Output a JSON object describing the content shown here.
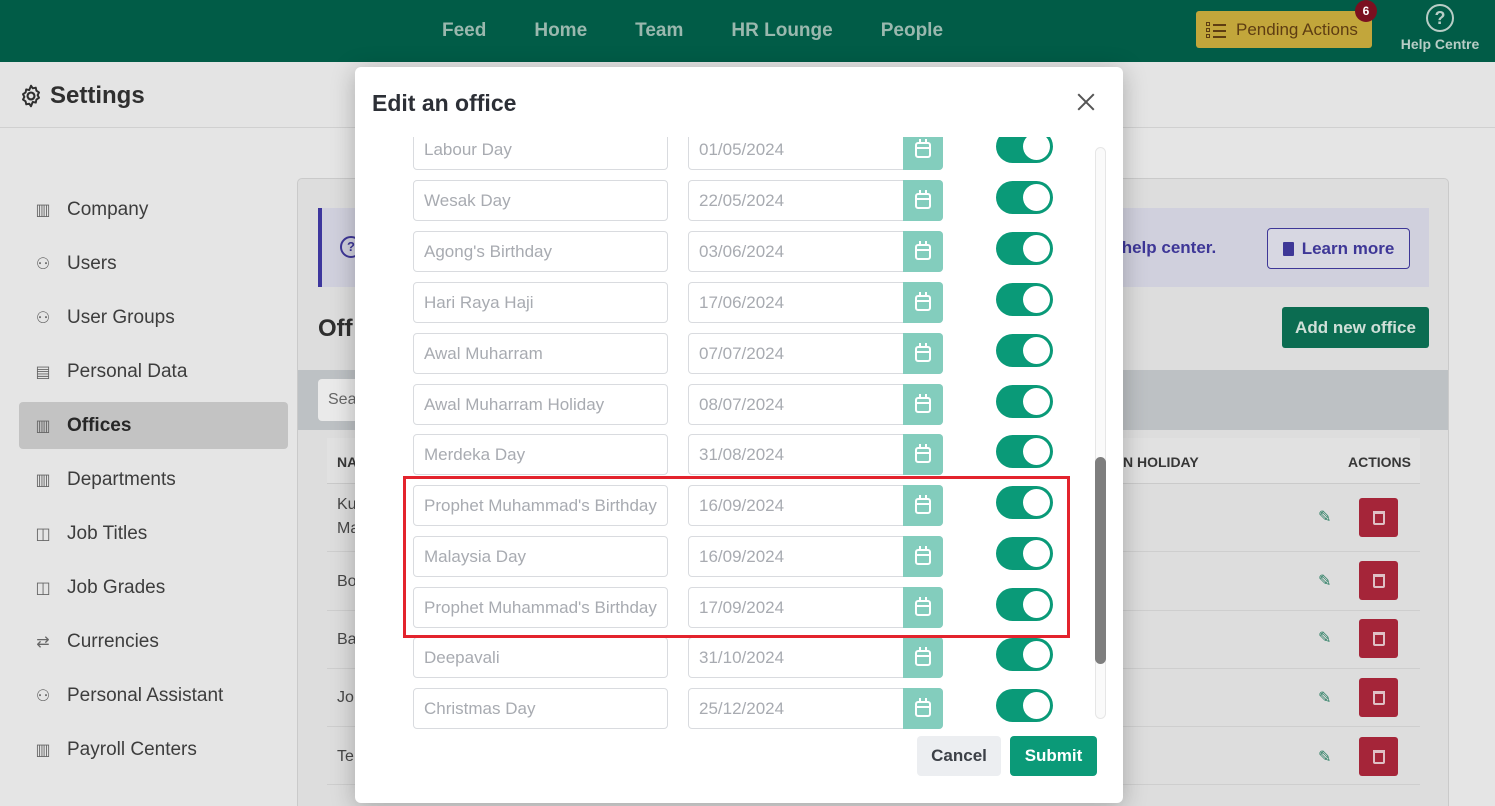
{
  "topnav": {
    "items": [
      "Feed",
      "Home",
      "Team",
      "HR Lounge",
      "People"
    ],
    "pending_label": "Pending Actions",
    "pending_count": "6",
    "help_label": "Help Centre"
  },
  "settings": {
    "title": "Settings"
  },
  "sidebar": {
    "items": [
      {
        "label": "Company",
        "icon": "building-icon"
      },
      {
        "label": "Users",
        "icon": "users-icon"
      },
      {
        "label": "User Groups",
        "icon": "users-icon"
      },
      {
        "label": "Personal Data",
        "icon": "id-card-icon"
      },
      {
        "label": "Offices",
        "icon": "building-icon"
      },
      {
        "label": "Departments",
        "icon": "building-icon"
      },
      {
        "label": "Job Titles",
        "icon": "briefcase-icon"
      },
      {
        "label": "Job Grades",
        "icon": "briefcase-icon"
      },
      {
        "label": "Currencies",
        "icon": "exchange-icon"
      },
      {
        "label": "Personal Assistant",
        "icon": "users-icon"
      },
      {
        "label": "Payroll Centers",
        "icon": "building-icon"
      }
    ],
    "active": "Offices"
  },
  "main": {
    "info_text": "ur help center.",
    "learn_more": "Learn more",
    "title_partial": "Off",
    "add_new": "Add new office",
    "search_partial": "Sea",
    "col_name_partial": "NA",
    "col_holiday_partial": "N HOLIDAY",
    "col_actions": "ACTIONS",
    "rows_partial": [
      "Ku",
      "Ma",
      "Bo",
      "Ba",
      "Jo",
      "Te"
    ]
  },
  "modal": {
    "title": "Edit an office",
    "holidays": [
      {
        "name": "Labour Day",
        "date": "01/05/2024",
        "enabled": true
      },
      {
        "name": "Wesak Day",
        "date": "22/05/2024",
        "enabled": true
      },
      {
        "name": "Agong's Birthday",
        "date": "03/06/2024",
        "enabled": true
      },
      {
        "name": "Hari Raya Haji",
        "date": "17/06/2024",
        "enabled": true
      },
      {
        "name": "Awal Muharram",
        "date": "07/07/2024",
        "enabled": true
      },
      {
        "name": "Awal Muharram Holiday",
        "date": "08/07/2024",
        "enabled": true
      },
      {
        "name": "Merdeka Day",
        "date": "31/08/2024",
        "enabled": true
      },
      {
        "name": "Prophet Muhammad's Birthday",
        "date": "16/09/2024",
        "enabled": true
      },
      {
        "name": "Malaysia Day",
        "date": "16/09/2024",
        "enabled": true
      },
      {
        "name": "Prophet Muhammad's Birthday",
        "date": "17/09/2024",
        "enabled": true
      },
      {
        "name": "Deepavali",
        "date": "31/10/2024",
        "enabled": true
      },
      {
        "name": "Christmas Day",
        "date": "25/12/2024",
        "enabled": true
      }
    ],
    "cancel_label": "Cancel",
    "submit_label": "Submit"
  },
  "colors": {
    "brand": "#015c47",
    "accent": "#0b9a78",
    "highlight": "#e3232d",
    "danger": "#a82036"
  }
}
